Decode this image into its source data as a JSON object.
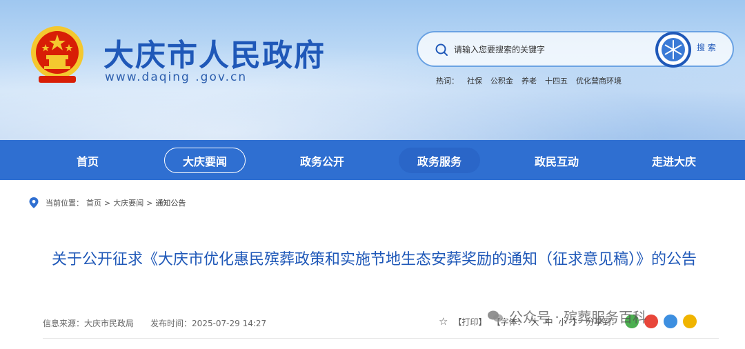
{
  "header": {
    "site_title": "大庆市人民政府",
    "site_url": "www.daqing .gov.cn"
  },
  "search": {
    "placeholder": "请输入您要搜索的关键字",
    "button_label": "搜 索",
    "hot_label": "热词：",
    "hot_words": [
      "社保",
      "公积金",
      "养老",
      "十四五",
      "优化营商环境"
    ]
  },
  "nav": {
    "items": [
      "首页",
      "大庆要闻",
      "政务公开",
      "政务服务",
      "政民互动",
      "走进大庆"
    ],
    "active_index": 1
  },
  "breadcrumb": {
    "label": "当前位置：",
    "items": [
      "首页",
      "大庆要闻",
      "通知公告"
    ],
    "separator": ">"
  },
  "article": {
    "title": "关于公开征求《大庆市优化惠民殡葬政策和实施节地生态安葬奖励的通知（征求意见稿）》的公告",
    "source_label": "信息来源：",
    "source": "大庆市民政局",
    "date_label": "发布时间：",
    "date": "2025-07-29 14:27"
  },
  "tools": {
    "print": "【打印】",
    "font_label": "【字体：",
    "font_large": "大",
    "font_medium": "中",
    "font_small": "小",
    "font_close": "】",
    "share_label": "分享到："
  },
  "watermark": {
    "text": "公众号 · 殡葬服务百科"
  },
  "colors": {
    "nav_bg": "#2f6fd1",
    "title_blue": "#1f58b8",
    "emblem_red": "#d81e06",
    "emblem_gold": "#f4c82f"
  }
}
